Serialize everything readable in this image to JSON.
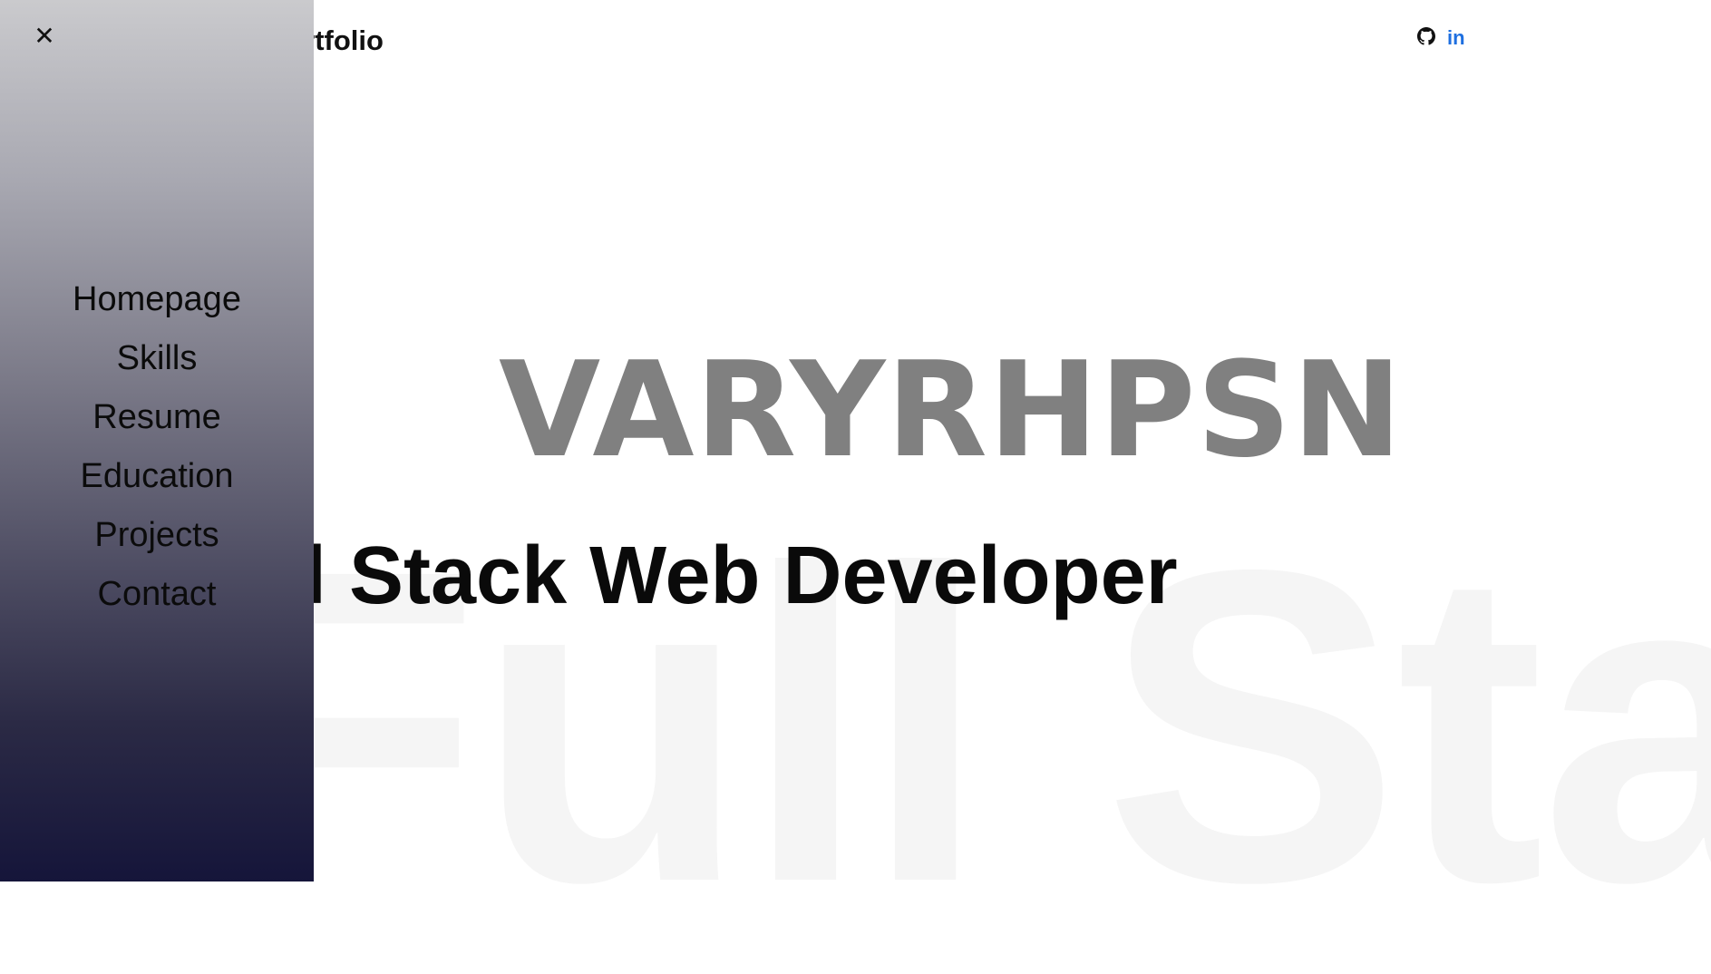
{
  "header": {
    "brand_title": "Arun's Portfolio",
    "social": [
      {
        "icon": "github-icon"
      },
      {
        "icon": "linkedin-icon",
        "text": "in"
      }
    ]
  },
  "hero": {
    "scramble_text": "VARYRHPSN",
    "role_title": "Full Stack Web Developer",
    "background_text": "Full Sta"
  },
  "drawer": {
    "close_icon": "✕",
    "nav_items": [
      {
        "label": "Homepage"
      },
      {
        "label": "Skills"
      },
      {
        "label": "Resume"
      },
      {
        "label": "Education"
      },
      {
        "label": "Projects"
      },
      {
        "label": "Contact"
      }
    ]
  },
  "colors": {
    "linkedin": "#1e6fe0",
    "scramble": "#808080",
    "drawer_top": "#cacacd",
    "drawer_bottom": "#15153a"
  }
}
